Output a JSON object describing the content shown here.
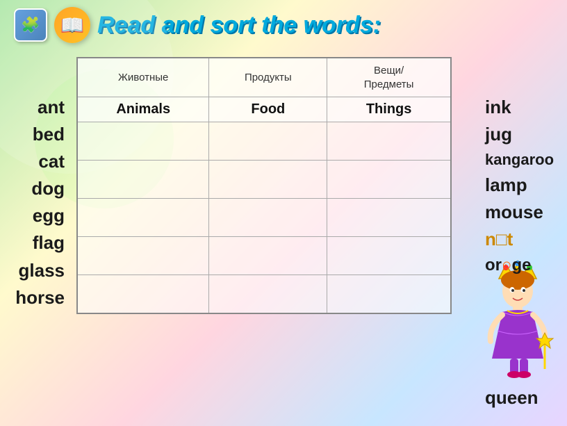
{
  "header": {
    "title": "Read and sort the words:"
  },
  "table": {
    "columns": [
      {
        "russian_label": "Животные",
        "english_label": "Animals"
      },
      {
        "russian_label": "Продукты",
        "english_label": "Food"
      },
      {
        "russian_label": "Вещи/ Предметы",
        "english_label": "Things"
      }
    ],
    "data_rows": 5
  },
  "words_left": [
    "ant",
    "bed",
    "cat",
    "dog",
    "egg",
    "flag",
    "glass",
    "horse"
  ],
  "words_right": [
    "ink",
    "jug",
    "kangaroo",
    "lamp",
    "mouse",
    "n_t",
    "or_ge",
    "queen"
  ]
}
